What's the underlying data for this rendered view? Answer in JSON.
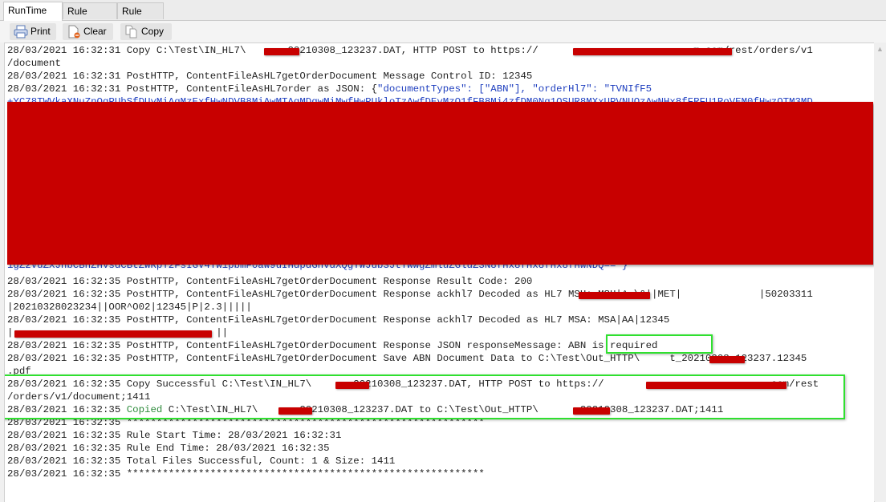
{
  "tabs": [
    {
      "label": "RunTime Log",
      "active": true
    },
    {
      "label": "Rule Report",
      "active": false
    },
    {
      "label": "Rule Info",
      "active": false
    }
  ],
  "toolbar": {
    "print": {
      "label": "Print",
      "icon": "printer-icon"
    },
    "clear": {
      "label": "Clear",
      "icon": "clear-document-icon"
    },
    "copy": {
      "label": "Copy",
      "icon": "copy-icon"
    }
  },
  "colors": {
    "redaction": "#c80000",
    "highlight_box": "#2fe02f",
    "json_text": "#1f3fbf",
    "copied_text": "#2e8b3c"
  },
  "log": {
    "lines": [
      "28/03/2021 16:32:31 Copy C:\\Test\\IN_HL7\\      _20210308_123237.DAT, HTTP POST to https://                          m.com/rest/orders/v1",
      "/document",
      "28/03/2021 16:32:31 PostHTTP, ContentFileAsHL7getOrderDocument Message Control ID: 12345",
      "28/03/2021 16:32:31 PostHTTP, ContentFileAsHL7order as JSON: {",
      "",
      "1gZ2VuZXJhbCBhZHVsdCBtZWRpY2FsIGV4YW1pbmF0aW9uIHdpdGhvdXQgYWJub3JtYWwgZmluZGluZ3N8fHx8fHx8fHx8fHwNDQ==\"}",
      "28/03/2021 16:32:35 PostHTTP, ContentFileAsHL7getOrderDocument Response Result Code: 200",
      "28/03/2021 16:32:35 PostHTTP, ContentFileAsHL7getOrderDocument Response ackhl7 Decoded as HL7 MSH: MSH|^~\\&||MET|             |50203311",
      "|20210328023234||OOR^O02|12345|P|2.3|||||",
      "28/03/2021 16:32:35 PostHTTP, ContentFileAsHL7getOrderDocument Response ackhl7 Decoded as HL7 MSA: MSA|AA|12345",
      "|                                  ||",
      "28/03/2021 16:32:35 PostHTTP, ContentFileAsHL7getOrderDocument Response JSON responseMessage: ABN is required",
      "28/03/2021 16:32:35 PostHTTP, ContentFileAsHL7getOrderDocument Save ABN Document Data to C:\\Test\\Out_HTTP\\     t_20210308_123237.12345",
      ".pdf",
      "28/03/2021 16:32:35 Copy Successful C:\\Test\\IN_HL7\\      _20210308_123237.DAT, HTTP POST to https://                           .com/rest",
      "/orders/v1/document;1411",
      "28/03/2021 16:32:35 ",
      "28/03/2021 16:32:35 ************************************************************",
      "28/03/2021 16:32:35 Rule Start Time: 28/03/2021 16:32:31",
      "28/03/2021 16:32:35 Rule End Time: 28/03/2021 16:32:35",
      "28/03/2021 16:32:35 Total Files Successful, Count: 1 & Size: 1411",
      "28/03/2021 16:32:35 ************************************************************"
    ],
    "json_fragment": "\"documentTypes\": [\"ABN\"], \"orderHl7\": \"TVNIfF5",
    "partial_base64_line": "+YC78TWVkaXNuZnQgPUbSfDUyMiAgMzExfHwNDVB8MiAwMTAgMDgwMiMwfHwPUkloTzAwfDEyMzQ1fFB8Mi4zfDM0Ng1OSUR8MXxUPVNUQzAwNHx8fFRFU1RoVEM0fHwzOTM3MD",
    "copied_word": "Copied",
    "copied_rest": " C:\\Test\\IN_HL7\\      _20210308_123237.DAT to C:\\Test\\Out_HTTP\\      _20210308_123237.DAT;1411"
  }
}
